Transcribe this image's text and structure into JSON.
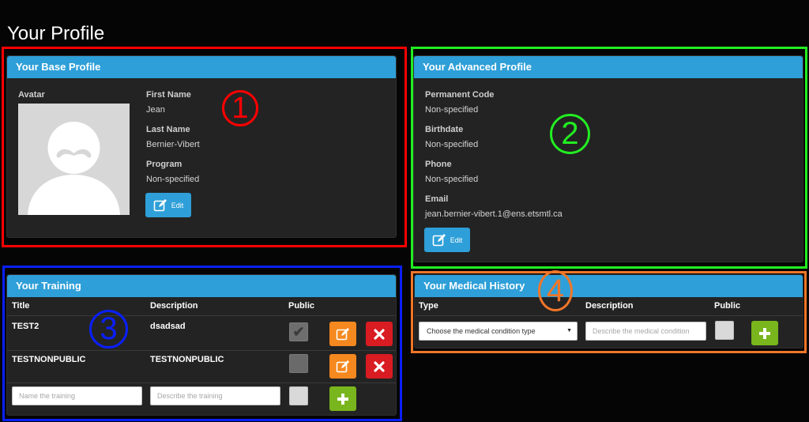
{
  "page": {
    "title": "Your Profile"
  },
  "markers": [
    "1",
    "2",
    "3",
    "4"
  ],
  "colors": {
    "panel_header": "#2e9fd8",
    "outline_1": "#ff0000",
    "outline_2": "#22ee22",
    "outline_3": "#0a1fff",
    "outline_4": "#f07628"
  },
  "base_profile": {
    "header": "Your Base Profile",
    "avatar_label": "Avatar",
    "first_name_label": "First Name",
    "first_name": "Jean",
    "last_name_label": "Last Name",
    "last_name": "Bernier-Vibert",
    "program_label": "Program",
    "program": "Non-specified",
    "edit_label": "Edit"
  },
  "advanced_profile": {
    "header": "Your Advanced Profile",
    "permanent_code_label": "Permanent Code",
    "permanent_code": "Non-specified",
    "birthdate_label": "Birthdate",
    "birthdate": "Non-specified",
    "phone_label": "Phone",
    "phone": "Non-specified",
    "email_label": "Email",
    "email": "jean.bernier-vibert.1@ens.etsmtl.ca",
    "edit_label": "Edit"
  },
  "training": {
    "header": "Your Training",
    "columns": [
      "Title",
      "Description",
      "Public"
    ],
    "rows": [
      {
        "title": "TEST2",
        "description": "dsadsad",
        "public": true
      },
      {
        "title": "TESTNONPUBLIC",
        "description": "TESTNONPUBLIC",
        "public": false
      }
    ],
    "new_title_placeholder": "Name the training",
    "new_description_placeholder": "Describe the training"
  },
  "medical_history": {
    "header": "Your Medical History",
    "columns": [
      "Type",
      "Description",
      "Public"
    ],
    "type_select": "Choose the medical condition type",
    "description_placeholder": "Describe the medical condition"
  }
}
